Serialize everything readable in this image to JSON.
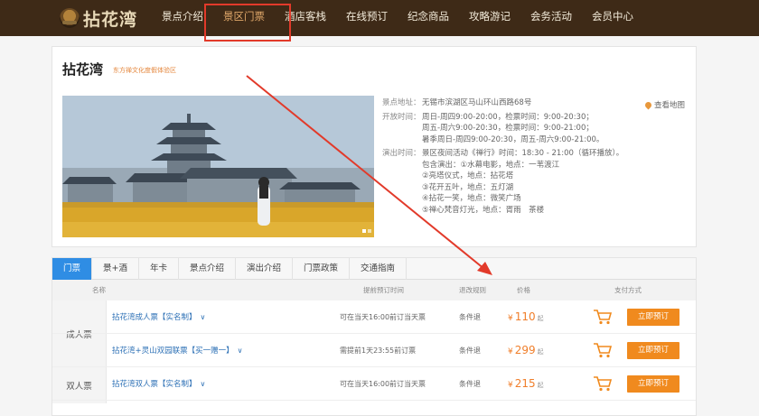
{
  "brand": {
    "logo_text": "拈花湾"
  },
  "nav": {
    "items": [
      "景点介绍",
      "景区门票",
      "酒店客栈",
      "在线预订",
      "纪念商品",
      "攻略游记",
      "会务活动",
      "会员中心"
    ],
    "active_index": 1
  },
  "spot": {
    "title": "拈花湾",
    "subtitle": "东方禅文化度假体验区",
    "map_link": "查看地图",
    "info": [
      {
        "key": "景点地址：",
        "lines": [
          "无锡市滨湖区马山环山西路68号"
        ]
      },
      {
        "key": "开放时间：",
        "lines": [
          "周日-周四9:00-20:00，检票时间：9:00-20:30；",
          "周五-周六9:00-20:30，检票时间：9:00-21:00；",
          "暑季周日-周四9:00-20:30，周五-周六9:00-21:00。"
        ]
      },
      {
        "key": "演出时间：",
        "lines": [
          "景区夜间活动《禅行》时间：18:30 - 21:00（循环播放）。",
          "包含演出：①水幕电影，地点：一苇渡江",
          "②亮塔仪式，地点：拈花塔",
          "③花开五叶，地点：五灯湖",
          "④拈花一笑，地点：微笑广场",
          "⑤禅心梵音灯光，地点：胥雨　茶楼"
        ]
      }
    ]
  },
  "tabs": [
    "门票",
    "景+酒",
    "年卡",
    "景点介绍",
    "演出介绍",
    "门票政策",
    "交通指南"
  ],
  "table": {
    "headers": {
      "name": "名称",
      "time": "提前预订时间",
      "refund": "退改规则",
      "price": "价格",
      "pay": "支付方式"
    },
    "rows": [
      {
        "category": "成人票",
        "name": "拈花湾成人票【实名制】",
        "time": "可在当天16:00前订当天票",
        "refund": "条件退",
        "currency": "¥",
        "price": "110",
        "qi": "起",
        "button": "立即预订"
      },
      {
        "category": "",
        "name": "拈花湾+灵山双园联票【买一赠一】",
        "time": "需提前1天23:55前订票",
        "refund": "条件退",
        "currency": "¥",
        "price": "299",
        "qi": "起",
        "button": "立即预订"
      },
      {
        "category": "双人票",
        "name": "拈花湾双人票【实名制】",
        "time": "可在当天16:00前订当天票",
        "refund": "条件退",
        "currency": "¥",
        "price": "215",
        "qi": "起",
        "button": "立即预订"
      }
    ]
  },
  "colors": {
    "header_bg": "#3e2a17",
    "accent_orange": "#f08a1e",
    "tab_blue": "#2f8de4",
    "annotation_red": "#e23a2a"
  }
}
